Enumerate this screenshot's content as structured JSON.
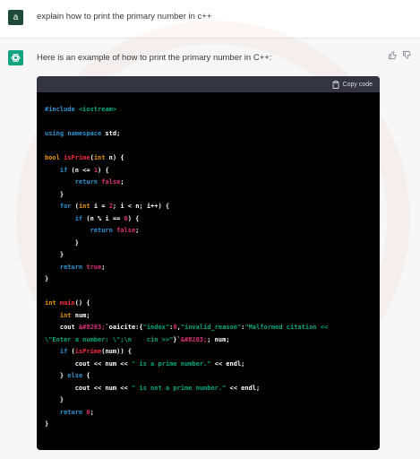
{
  "user": {
    "avatar_letter": "a",
    "message": "explain how to print the primary number in c++"
  },
  "assistant": {
    "avatar_icon": "openai-logo-icon",
    "message": "Here is an example of how to print the primary number in C++:",
    "feedback": [
      "thumbs-up-icon",
      "thumbs-down-icon"
    ]
  },
  "code_block": {
    "copy_label": "Copy code",
    "copy_icon": "clipboard-icon",
    "lines": [
      [
        {
          "t": "#include ",
          "c": "k"
        },
        {
          "t": "<iostream>",
          "c": "s"
        }
      ],
      [],
      [
        {
          "t": "using namespace",
          "c": "k"
        },
        {
          "t": " std;",
          "c": ""
        }
      ],
      [],
      [
        {
          "t": "bool ",
          "c": "d"
        },
        {
          "t": "isPrime",
          "c": "f"
        },
        {
          "t": "(",
          "c": ""
        },
        {
          "t": "int",
          "c": "d"
        },
        {
          "t": " n) {",
          "c": ""
        }
      ],
      [
        {
          "t": "    ",
          "c": ""
        },
        {
          "t": "if",
          "c": "k"
        },
        {
          "t": " (n <= ",
          "c": ""
        },
        {
          "t": "1",
          "c": "n"
        },
        {
          "t": ") {",
          "c": ""
        }
      ],
      [
        {
          "t": "        ",
          "c": ""
        },
        {
          "t": "return",
          "c": "k"
        },
        {
          "t": " ",
          "c": ""
        },
        {
          "t": "false",
          "c": "n"
        },
        {
          "t": ";",
          "c": ""
        }
      ],
      [
        {
          "t": "    }",
          "c": ""
        }
      ],
      [
        {
          "t": "    ",
          "c": ""
        },
        {
          "t": "for",
          "c": "k"
        },
        {
          "t": " (",
          "c": ""
        },
        {
          "t": "int",
          "c": "d"
        },
        {
          "t": " i = ",
          "c": ""
        },
        {
          "t": "2",
          "c": "n"
        },
        {
          "t": "; i < n; i++) {",
          "c": ""
        }
      ],
      [
        {
          "t": "        ",
          "c": ""
        },
        {
          "t": "if",
          "c": "k"
        },
        {
          "t": " (n % i == ",
          "c": ""
        },
        {
          "t": "0",
          "c": "n"
        },
        {
          "t": ") {",
          "c": ""
        }
      ],
      [
        {
          "t": "            ",
          "c": ""
        },
        {
          "t": "return",
          "c": "k"
        },
        {
          "t": " ",
          "c": ""
        },
        {
          "t": "false",
          "c": "n"
        },
        {
          "t": ";",
          "c": ""
        }
      ],
      [
        {
          "t": "        }",
          "c": ""
        }
      ],
      [
        {
          "t": "    }",
          "c": ""
        }
      ],
      [
        {
          "t": "    ",
          "c": ""
        },
        {
          "t": "return",
          "c": "k"
        },
        {
          "t": " ",
          "c": ""
        },
        {
          "t": "true",
          "c": "n"
        },
        {
          "t": ";",
          "c": ""
        }
      ],
      [
        {
          "t": "}",
          "c": ""
        }
      ],
      [],
      [
        {
          "t": "int ",
          "c": "d"
        },
        {
          "t": "main",
          "c": "f"
        },
        {
          "t": "() {",
          "c": ""
        }
      ],
      [
        {
          "t": "    ",
          "c": ""
        },
        {
          "t": "int",
          "c": "d"
        },
        {
          "t": " num;",
          "c": ""
        }
      ],
      [
        {
          "t": "    cout ",
          "c": ""
        },
        {
          "t": "&#8203;",
          "c": "n"
        },
        {
          "t": "`oaicite:{",
          "c": ""
        },
        {
          "t": "\"index\"",
          "c": "s"
        },
        {
          "t": ":",
          "c": ""
        },
        {
          "t": "0",
          "c": "n"
        },
        {
          "t": ",",
          "c": ""
        },
        {
          "t": "\"invalid_reason\"",
          "c": "s"
        },
        {
          "t": ":",
          "c": ""
        },
        {
          "t": "\"Malformed citation <<",
          "c": "s"
        }
      ],
      [
        {
          "t": "\\\"Enter a number: \\\";\\n    cin >>\"",
          "c": "s"
        },
        {
          "t": "}`",
          "c": ""
        },
        {
          "t": "&#8203;",
          "c": "n"
        },
        {
          "t": "; num;",
          "c": ""
        }
      ],
      [
        {
          "t": "    ",
          "c": ""
        },
        {
          "t": "if",
          "c": "k"
        },
        {
          "t": " (",
          "c": ""
        },
        {
          "t": "isPrime",
          "c": "f"
        },
        {
          "t": "(num)) {",
          "c": ""
        }
      ],
      [
        {
          "t": "        cout << num << ",
          "c": ""
        },
        {
          "t": "\" is a prime number.\"",
          "c": "s"
        },
        {
          "t": " << endl;",
          "c": ""
        }
      ],
      [
        {
          "t": "    } ",
          "c": ""
        },
        {
          "t": "else",
          "c": "k"
        },
        {
          "t": " {",
          "c": ""
        }
      ],
      [
        {
          "t": "        cout << num << ",
          "c": ""
        },
        {
          "t": "\" is not a prime number.\"",
          "c": "s"
        },
        {
          "t": " << endl;",
          "c": ""
        }
      ],
      [
        {
          "t": "    }",
          "c": ""
        }
      ],
      [
        {
          "t": "    ",
          "c": ""
        },
        {
          "t": "return",
          "c": "k"
        },
        {
          "t": " ",
          "c": ""
        },
        {
          "t": "0",
          "c": "n"
        },
        {
          "t": ";",
          "c": ""
        }
      ],
      [
        {
          "t": "}",
          "c": ""
        }
      ]
    ]
  },
  "colors": {
    "keyword": "#2e95d3",
    "type": "#e9950c",
    "number": "#df3079",
    "string": "#00a67d",
    "function": "#f22c3d",
    "user_avatar": "#1f4a3a",
    "assistant_avatar": "#10a37f"
  }
}
